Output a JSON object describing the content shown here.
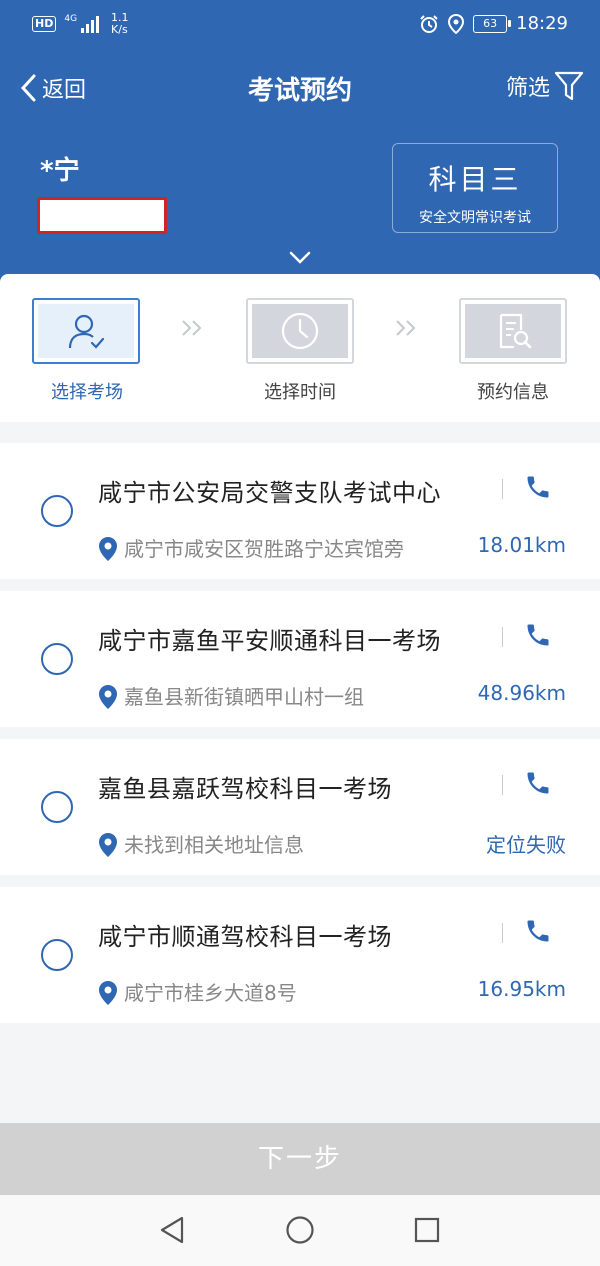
{
  "status_bar": {
    "hd": "HD",
    "network": "4G",
    "speed_value": "1.1",
    "speed_unit": "K/s",
    "battery": "63",
    "time": "18:29"
  },
  "nav": {
    "back_label": "返回",
    "title": "考试预约",
    "filter_label": "筛选"
  },
  "user": {
    "name": "*宁"
  },
  "subject": {
    "title": "科目三",
    "subtitle": "安全文明常识考试"
  },
  "steps": [
    {
      "label": "选择考场",
      "icon": "user-check-icon",
      "active": true
    },
    {
      "label": "选择时间",
      "icon": "clock-icon",
      "active": false
    },
    {
      "label": "预约信息",
      "icon": "document-search-icon",
      "active": false
    }
  ],
  "venues": [
    {
      "name": "咸宁市公安局交警支队考试中心",
      "address": "咸宁市咸安区贺胜路宁达宾馆旁",
      "distance": "18.01km"
    },
    {
      "name": "咸宁市嘉鱼平安顺通科目一考场",
      "address": "嘉鱼县新街镇晒甲山村一组",
      "distance": "48.96km"
    },
    {
      "name": "嘉鱼县嘉跃驾校科目一考场",
      "address": "未找到相关地址信息",
      "distance": "定位失败"
    },
    {
      "name": "咸宁市顺通驾校科目一考场",
      "address": "咸宁市桂乡大道8号",
      "distance": "16.95km"
    }
  ],
  "next_button": "下一步",
  "colors": {
    "primary": "#2f67b3",
    "accent": "#3d7fce",
    "disabled": "#d1d1d1"
  }
}
